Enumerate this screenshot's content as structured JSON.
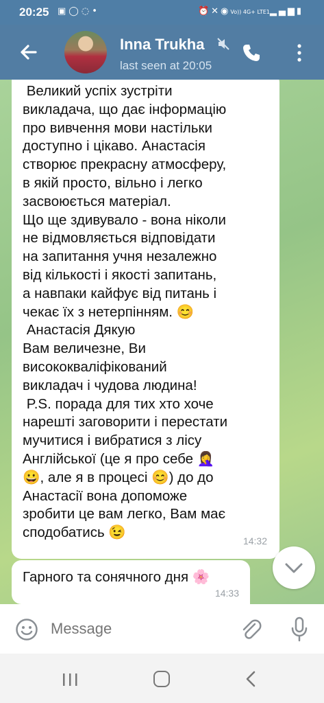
{
  "status_bar": {
    "time": "20:25",
    "left_icons": [
      "image-icon",
      "whatsapp-icon",
      "viber-icon",
      "dot-icon"
    ],
    "right_icons": [
      "alarm-icon",
      "mute-icon",
      "hotspot-icon",
      "signal-icon",
      "wifi-icon",
      "battery-icon"
    ],
    "network_label": "Vo)) 4G+ LTE1"
  },
  "header": {
    "contact_name": "Inna Trukha",
    "last_seen": "last seen at 20:05",
    "colors": {
      "header_bg": "#527da3",
      "status_bg": "#4f7ea6"
    }
  },
  "messages": [
    {
      "text": " Великий успіх зустріти\nвикладача, що дає інформацію\nпро вивчення мови настільки\nдоступно і цікаво. Анастасія\nстворює прекрасну атмосферу,\nв якій просто, вільно і легко\nзасвоюється матеріал.\nЩо ще здивувало - вона ніколи\nне відмовляється відповідати\nна запитання учня незалежно\nвід кількості і якості запитань,\nа навпаки кайфує від питань і\nчекає їх з нетерпінням. 😊\n Анастасія Дякую\nВам величезне, Ви\nвисококваліфікований\nвикладач і чудова людина!\n P.S. порада для тих хто хоче\nнарешті заговорити і перестати\nмучитися і вибратися з лісу\nАнглійської (це я про себе 🤦‍♀️\n😀, але я в процесі 😊) до до\nАнастасії вона допоможе\nзробити це вам легко, Вам має\nсподобатись 😉",
      "time": "14:32"
    },
    {
      "text": "Гарного та сонячного дня 🌸",
      "time": "14:33"
    }
  ],
  "input": {
    "placeholder": "Message"
  }
}
